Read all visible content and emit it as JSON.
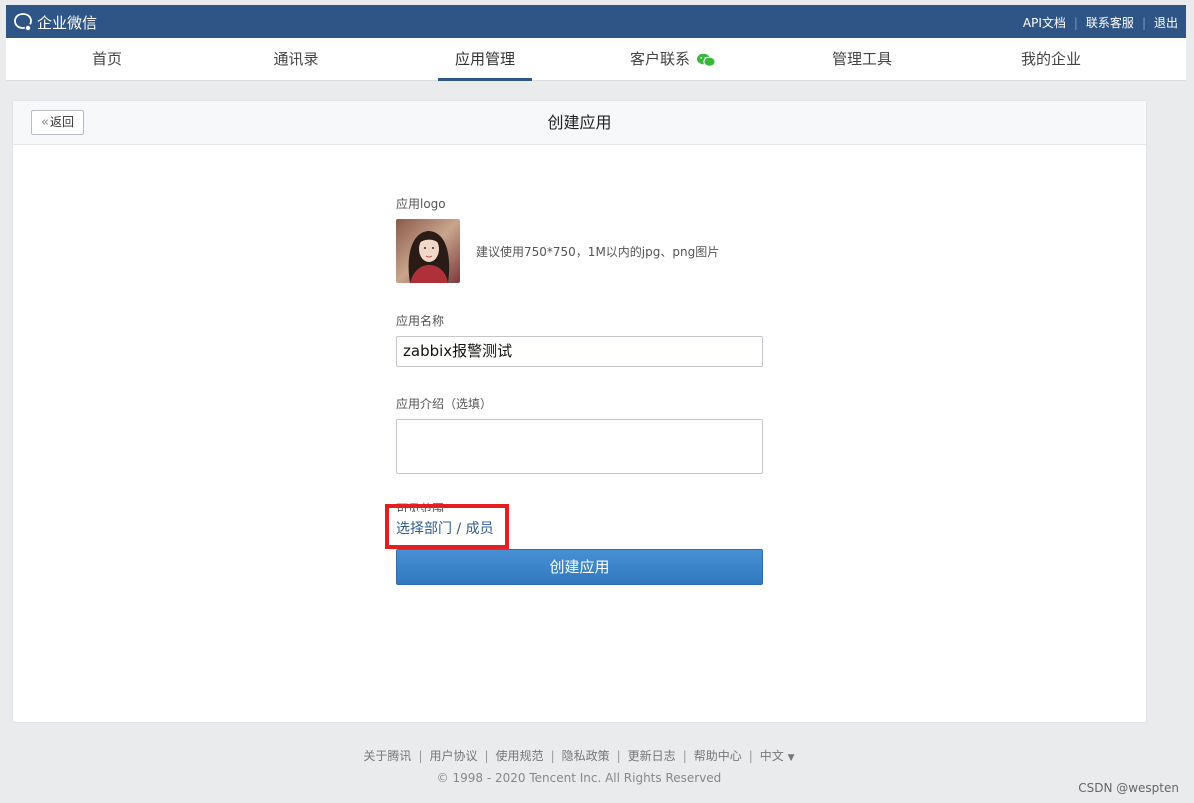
{
  "header": {
    "brand": "企业微信",
    "links": [
      "API文档",
      "联系客服",
      "退出"
    ]
  },
  "nav": {
    "items": [
      "首页",
      "通讯录",
      "应用管理",
      "客户联系",
      "管理工具",
      "我的企业"
    ],
    "active_index": 2
  },
  "page": {
    "back_label": "返回",
    "title": "创建应用"
  },
  "form": {
    "logo_label": "应用logo",
    "logo_hint": "建议使用750*750，1M以内的jpg、png图片",
    "name_label": "应用名称",
    "name_value": "zabbix报警测试",
    "intro_label": "应用介绍（选填）",
    "intro_value": "",
    "visibility_label": "可见范围",
    "select_link": "选择部门 / 成员",
    "submit_label": "创建应用"
  },
  "footer": {
    "links": [
      "关于腾讯",
      "用户协议",
      "使用规范",
      "隐私政策",
      "更新日志",
      "帮助中心",
      "中文"
    ],
    "copyright": "© 1998 - 2020 Tencent Inc. All Rights Reserved"
  },
  "watermark": "CSDN @wespten",
  "colors": {
    "topbar": "#2f5486",
    "link": "#2f5b95",
    "primary_button": "#3f86cc",
    "highlight": "#e32020"
  }
}
